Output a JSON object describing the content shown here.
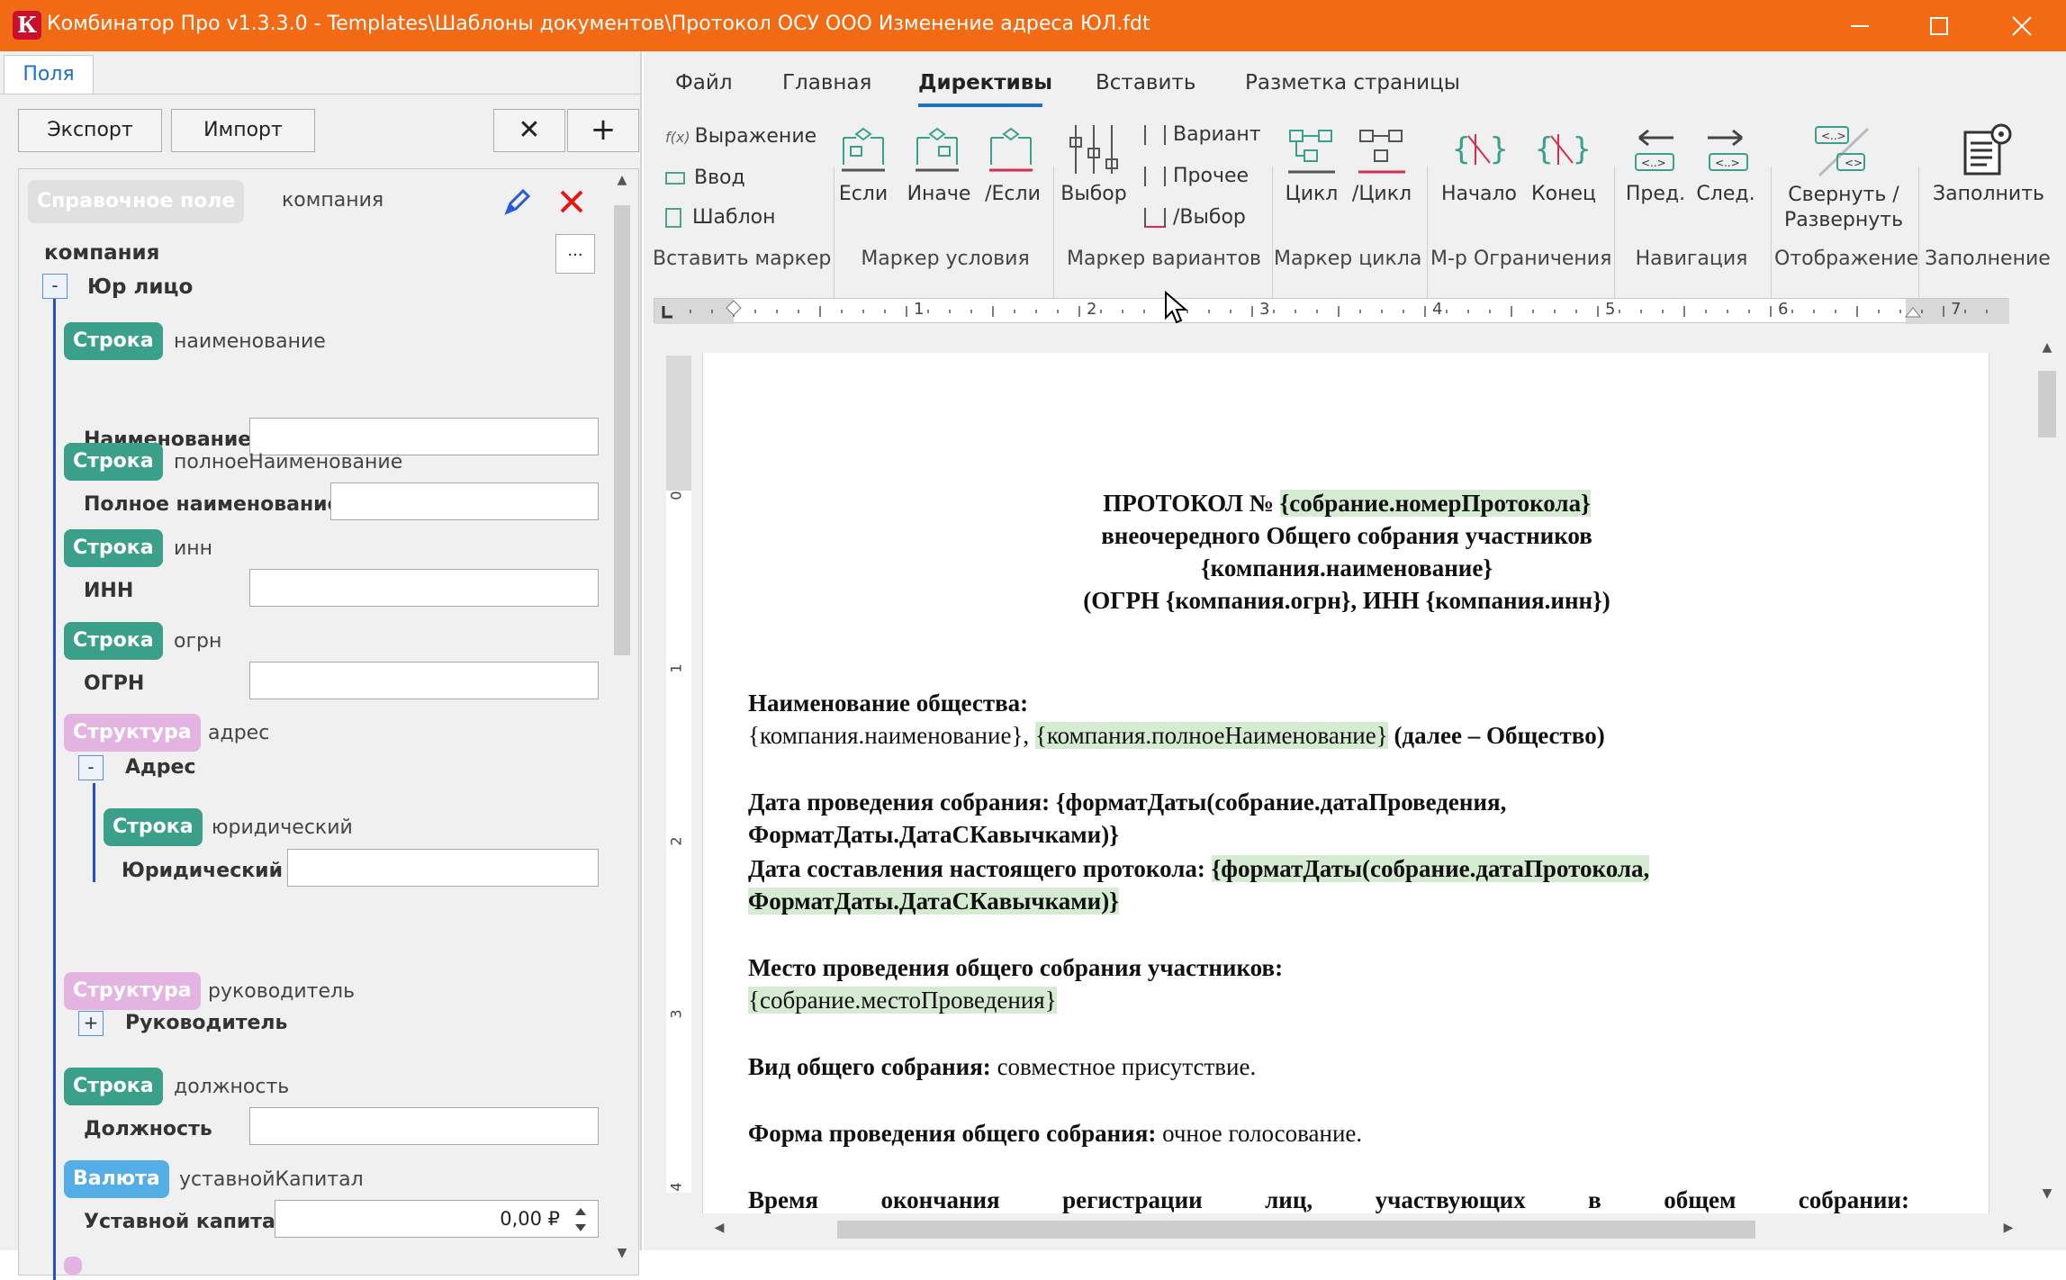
{
  "window": {
    "title": "Комбинатор Про v1.3.3.0 - Templates\\Шаблоны документов\\Протокол ОСУ ООО Изменение адреса ЮЛ.fdt",
    "app_icon": "К",
    "accent": "#f36a14"
  },
  "left": {
    "tab": "Поля",
    "export": "Экспорт",
    "import": "Импорт",
    "clear_icon": "✕",
    "add_icon": "+",
    "ref_chip": "Справочное поле",
    "ref_name": "компания",
    "root_label": "компания",
    "ellipsis": "...",
    "group_label": "Юр лицо",
    "fields": [
      {
        "chip": "Строка",
        "name": "наименование",
        "label": "Наименование",
        "value": ""
      },
      {
        "chip": "Строка",
        "name": "полноеНаименование",
        "label": "Полное наименование",
        "value": ""
      },
      {
        "chip": "Строка",
        "name": "инн",
        "label": "ИНН",
        "value": ""
      },
      {
        "chip": "Строка",
        "name": "огрн",
        "label": "ОГРН",
        "value": ""
      }
    ],
    "struct_address": {
      "chip": "Структура",
      "name": "адрес",
      "label": "Адрес"
    },
    "address_field": {
      "chip": "Строка",
      "name": "юридический",
      "label": "Юридический",
      "value": ""
    },
    "struct_manager": {
      "chip": "Структура",
      "name": "руководитель",
      "label": "Руководитель"
    },
    "position_field": {
      "chip": "Строка",
      "name": "должность",
      "label": "Должность",
      "value": ""
    },
    "capital_field": {
      "chip": "Валюта",
      "name": "уставнойКапитал",
      "label": "Уставной капитал",
      "value": "0,00 ₽"
    },
    "collapse_symbol": "-",
    "expand_symbol": "+"
  },
  "ribbon": {
    "tabs": [
      "Файл",
      "Главная",
      "Директивы",
      "Вставить",
      "Разметка страницы"
    ],
    "active_tab": "Директивы",
    "insert_marker": {
      "expression": "Выражение",
      "input": "Ввод",
      "template": "Шаблон",
      "group": "Вставить маркер"
    },
    "condition": {
      "if": "Если",
      "else": "Иначе",
      "endif": "/Если",
      "group": "Маркер условия"
    },
    "variants": {
      "choice": "Выбор",
      "variant": "Вариант",
      "other": "Прочее",
      "endchoice": "/Выбор",
      "group": "Маркер вариантов"
    },
    "loop": {
      "loop": "Цикл",
      "endloop": "/Цикл",
      "group": "Маркер цикла"
    },
    "limit": {
      "start": "Начало",
      "end": "Конец",
      "group": "М-р Ограничения"
    },
    "nav": {
      "prev": "Пред.",
      "next": "След.",
      "group": "Навигация"
    },
    "display": {
      "collapse1": "Свернуть /",
      "collapse2": "Развернуть",
      "group": "Отображение"
    },
    "fill": {
      "fill": "Заполнить",
      "group": "Заполнение"
    }
  },
  "ruler": {
    "marks": [
      "1",
      "2",
      "3",
      "4",
      "5",
      "6",
      "7"
    ],
    "vmarks": [
      "0",
      "1",
      "2",
      "3",
      "4"
    ]
  },
  "document": {
    "h1_a": "ПРОТОКОЛ № ",
    "h1_b": "{собрание.номерПротокола}",
    "h2": "внеочередного Общего собрания участников",
    "h3": "{компания.наименование}",
    "h4": "(ОГРН {компания.огрн}, ИНН {компания.инн})",
    "s1_title": "Наименование общества:",
    "s1_a": "{компания.наименование}, ",
    "s1_b": "{компания.полноеНаименование}",
    "s1_c": " (далее – Общество)",
    "s2_a": "Дата проведения собрания: {форматДаты(собрание.датаПроведения,",
    "s2_b": "ФорматДаты.ДатаСКавычками)}",
    "s3_a": "Дата составления настоящего протокола: ",
    "s3_b": "{форматДаты(собрание.датаПротокола,",
    "s3_c": "ФорматДаты.ДатаСКавычками)}",
    "s4_title": "Место проведения общего собрания участников:",
    "s4_val": "{собрание.местоПроведения}",
    "s5_title": "Вид общего собрания:",
    "s5_val": " совместное присутствие.",
    "s6_title": "Форма проведения общего собрания:",
    "s6_val": " очное голосование.",
    "s7_words": [
      "Время",
      "окончания",
      "регистрации",
      "лиц,",
      "участвующих",
      "в",
      "общем",
      "собрании:"
    ]
  }
}
